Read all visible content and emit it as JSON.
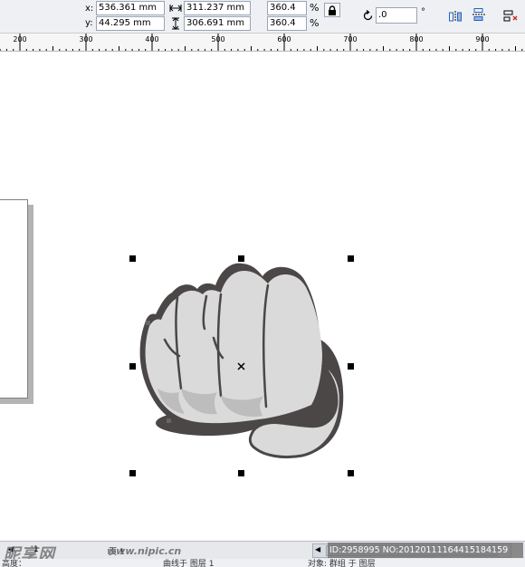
{
  "propbar": {
    "x_label": "x:",
    "y_label": "y:",
    "x_value": "536.361 mm",
    "y_value": "44.295 mm",
    "width_value": "311.237 mm",
    "height_value": "306.691 mm",
    "scale_x": "360.4",
    "scale_y": "360.4",
    "percent_x": "%",
    "percent_y": "%",
    "rotation_value": ".0",
    "degree_symbol": "°"
  },
  "ruler": {
    "labels": [
      "200",
      "300",
      "400",
      "500",
      "600",
      "700",
      "800",
      "900"
    ]
  },
  "bottombar": {
    "page_number": "1",
    "page_name": "页 1",
    "watermark_logo": "昵享网",
    "watermark_url": "www.nipic.cn",
    "id_text": "ID:2958995 NO:20120111164415184159"
  },
  "statusbar": {
    "left_text": "高度：",
    "mid_text": "曲线于 图层 1",
    "right_text": "对象: 群组 于 图层"
  },
  "colors": {
    "fist_fill": "#dadada",
    "fist_outline": "#4a4746",
    "shadow": "#4a4746",
    "accent_icon": "#1e64c8"
  },
  "icons": {
    "width": "width-arrows-icon",
    "height": "height-arrows-icon",
    "lock": "lock-ratio-icon",
    "rotate": "rotate-icon",
    "mirror_h": "mirror-horizontal-icon",
    "mirror_v": "mirror-vertical-icon",
    "center": "center-mark-icon"
  }
}
